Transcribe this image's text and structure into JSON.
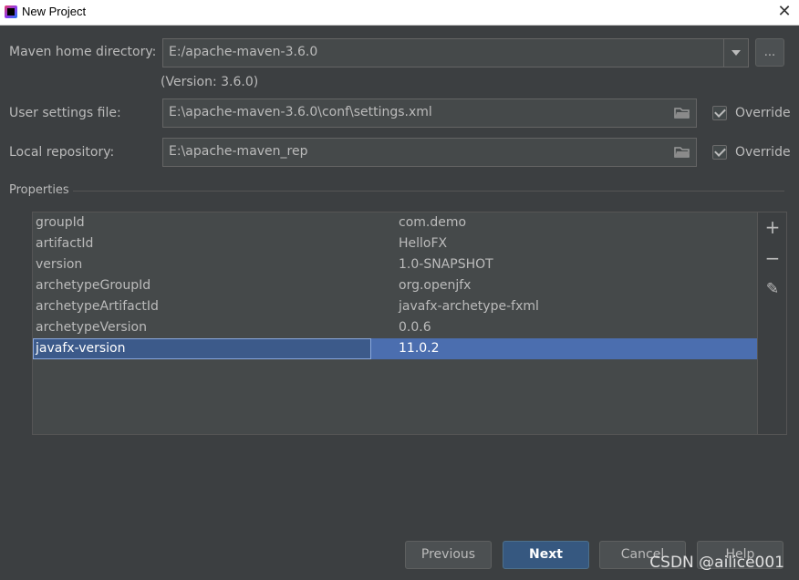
{
  "window": {
    "title": "New Project",
    "close_glyph": "✕"
  },
  "maven_home": {
    "label": "Maven home directory:",
    "value": "E:/apache-maven-3.6.0",
    "browse_label": "...",
    "version_text": "(Version: 3.6.0)"
  },
  "user_settings": {
    "label": "User settings file:",
    "value": "E:\\apache-maven-3.6.0\\conf\\settings.xml",
    "override_label": "Override"
  },
  "local_repo": {
    "label": "Local repository:",
    "value": "E:\\apache-maven_rep",
    "override_label": "Override"
  },
  "properties": {
    "section_label": "Properties",
    "rows": [
      {
        "key": "groupId",
        "value": "com.demo"
      },
      {
        "key": "artifactId",
        "value": "HelloFX"
      },
      {
        "key": "version",
        "value": "1.0-SNAPSHOT"
      },
      {
        "key": "archetypeGroupId",
        "value": "org.openjfx"
      },
      {
        "key": "archetypeArtifactId",
        "value": "javafx-archetype-fxml"
      },
      {
        "key": "archetypeVersion",
        "value": "0.0.6"
      },
      {
        "key": "javafx-version",
        "value": "11.0.2"
      }
    ],
    "tools": {
      "add_glyph": "+",
      "remove_glyph": "−",
      "edit_glyph": "✎"
    }
  },
  "buttons": {
    "previous": "Previous",
    "next": "Next",
    "cancel": "Cancel",
    "help": "Help"
  },
  "watermark": "CSDN @ailice001",
  "colors": {
    "background": "#3c3f41",
    "selection": "#4b6eaf",
    "primary_button": "#365880"
  }
}
